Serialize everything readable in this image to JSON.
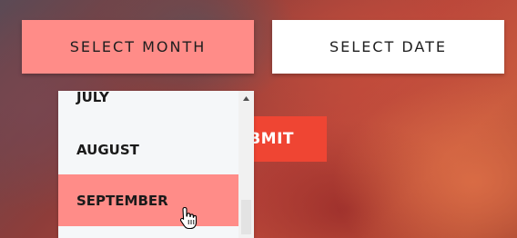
{
  "buttons": {
    "select_month": "SELECT MONTH",
    "select_date": "SELECT DATE",
    "submit": "BMIT"
  },
  "month_dropdown": {
    "options": [
      "JULY",
      "AUGUST",
      "SEPTEMBER"
    ],
    "highlighted": "SEPTEMBER"
  },
  "colors": {
    "accent_pink": "#ff8c88",
    "submit_red": "#ef4533",
    "dropdown_bg": "#f5f7f9"
  },
  "icons": {
    "scroll_up": "triangle-up-icon",
    "cursor": "hand-pointer-icon"
  }
}
